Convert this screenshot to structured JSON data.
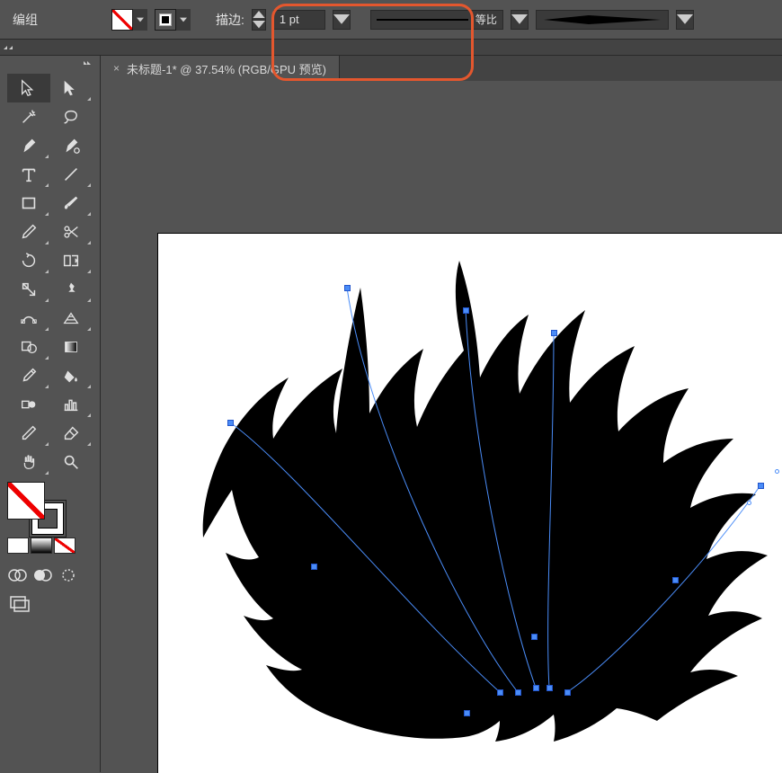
{
  "top": {
    "section_label": "编组",
    "stroke_label": "描边:",
    "stroke_value": "1 pt",
    "profile_text": "等比"
  },
  "tab": {
    "name": "未标题-1*",
    "zoom": "37.54%",
    "mode": "(RGB/GPU 预览)"
  },
  "tools": [
    [
      "selection",
      "direct-selection"
    ],
    [
      "magic-wand",
      "lasso"
    ],
    [
      "pen",
      "curvature-pen"
    ],
    [
      "type",
      "line-segment"
    ],
    [
      "rectangle",
      "paintbrush"
    ],
    [
      "pencil",
      "scissors"
    ],
    [
      "rotate",
      "reflect"
    ],
    [
      "scale",
      "pushpin"
    ],
    [
      "width",
      "free-transform"
    ],
    [
      "shape-builder",
      "perspective-grid"
    ],
    [
      "mesh",
      "gradient"
    ],
    [
      "eyedropper",
      "paint-bucket"
    ],
    [
      "blend",
      "column-graph"
    ],
    [
      "slice",
      "eraser"
    ],
    [
      "hand",
      "zoom"
    ]
  ],
  "colors": {
    "fill": "none",
    "stroke": "#ffffff"
  }
}
